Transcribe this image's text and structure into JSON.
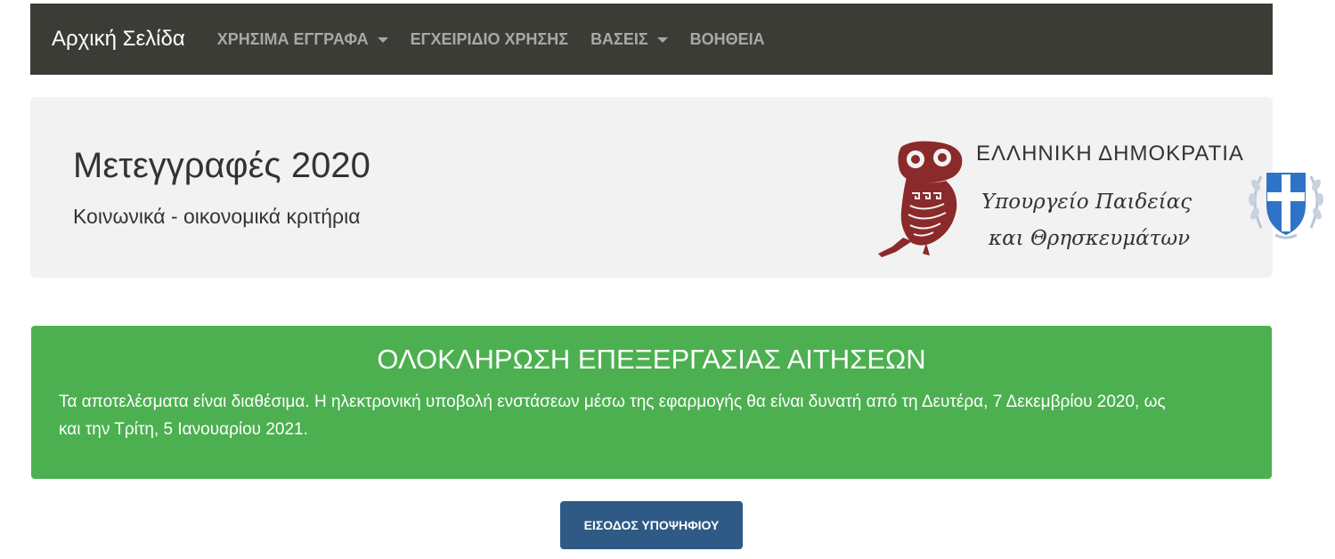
{
  "navbar": {
    "brand": "Αρχική Σελίδα",
    "items": [
      {
        "label": "ΧΡΗΣΙΜΑ ΕΓΓΡΑΦΑ",
        "dropdown": true
      },
      {
        "label": "ΕΓΧΕΙΡΙΔΙΟ ΧΡΗΣΗΣ",
        "dropdown": false
      },
      {
        "label": "ΒΑΣΕΙΣ",
        "dropdown": true
      },
      {
        "label": "ΒΟΗΘΕΙΑ",
        "dropdown": false
      }
    ]
  },
  "header": {
    "title": "Μετεγγραφές 2020",
    "subtitle": "Κοινωνικά - οικονομικά κριτήρια"
  },
  "logo": {
    "line1": "ΕΛΛΗΝΙΚΗ ΔΗΜΟΚΡΑΤΙΑ",
    "line2": "Υπουργείο Παιδείας",
    "line3": "και Θρησκευμάτων",
    "icon": "owl-icon",
    "emblem_icon": "greek-coat-of-arms-icon"
  },
  "alert": {
    "title": "ΟΛΟΚΛΗΡΩΣΗ ΕΠΕΞΕΡΓΑΣΙΑΣ ΑΙΤΗΣΕΩΝ",
    "body": "Τα αποτελέσματα είναι διαθέσιμα. Η ηλεκτρονική υποβολή ενστάσεων μέσω της εφαρμογής θα είναι δυνατή από τη Δευτέρα, 7 Δεκεμβρίου 2020, ως και την Τρίτη, 5 Ιανουαρίου 2021."
  },
  "login_button": {
    "label": "ΕΙΣΟΔΟΣ ΥΠΟΨΗΦΙΟΥ"
  },
  "colors": {
    "navbar_bg": "#3c3c37",
    "jumbotron_bg": "#f2f2f2",
    "alert_bg": "#4cb050",
    "button_bg": "#2e5a85",
    "owl": "#8b2a2a",
    "emblem": "#2f73c6"
  }
}
